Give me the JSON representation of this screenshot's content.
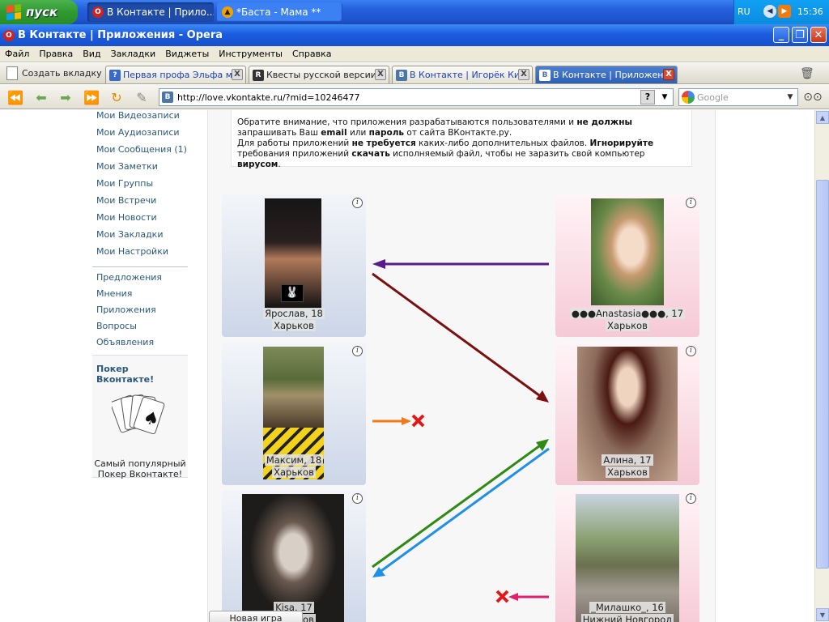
{
  "taskbar": {
    "start_label": "пуск",
    "tasks": [
      {
        "label": "В Контакте | Прило...",
        "active": true
      },
      {
        "label": "*Баста - Мама **",
        "active": false
      }
    ],
    "language": "RU",
    "clock": "15:36"
  },
  "window": {
    "title": "В Контакте | Приложения - Opera"
  },
  "menu": [
    "Файл",
    "Правка",
    "Вид",
    "Закладки",
    "Виджеты",
    "Инструменты",
    "Справка"
  ],
  "tabs": {
    "new_tab_label": "Создать вкладку",
    "items": [
      {
        "label": "Первая профа Эльфа м...",
        "active": false
      },
      {
        "label": "Квесты русской версии...",
        "active": false
      },
      {
        "label": "В Контакте | Игорёк Ки...",
        "active": false
      },
      {
        "label": "В Контакте | Приложения",
        "active": true
      }
    ],
    "close_glyph": "X"
  },
  "address": {
    "url": "http://love.vkontakte.ru/?mid=10246477",
    "help_glyph": "?",
    "search_placeholder": "Google"
  },
  "sidebar": {
    "items": [
      "Мои Видеозаписи",
      "Мои Аудиозаписи",
      "Мои Сообщения (1)",
      "Мои Заметки",
      "Мои Группы",
      "Мои Встречи",
      "Мои Новости",
      "Мои Закладки",
      "Мои Настройки"
    ],
    "items2": [
      "Предложения",
      "Мнения",
      "Приложения",
      "Вопросы",
      "Объявления"
    ],
    "poker": {
      "title": "Покер Вконтакте!",
      "caption_line1": "Самый популярный",
      "caption_line2": "Покер Вконтакте!"
    }
  },
  "notice": {
    "p1_a": "Обратите внимание, что приложения разрабатываются пользователями и ",
    "p1_b": "не должны",
    "p1_c": " запрашивать Ваш ",
    "p1_d": "email",
    "p1_e": " или ",
    "p1_f": "пароль",
    "p1_g": " от сайта ВКонтакте.ру.",
    "p2_a": "Для работы приложений ",
    "p2_b": "не требуется",
    "p2_c": " каких-либо дополнительных файлов. ",
    "p2_d": "Игнорируйте",
    "p2_e": " требования приложений ",
    "p2_f": "скачать",
    "p2_g": " исполняемый файл, чтобы не заразить свой компьютер ",
    "p2_h": "вирусом",
    "p2_i": "."
  },
  "profiles": {
    "male": [
      {
        "name": "Ярослав, 18",
        "city": "Харьков"
      },
      {
        "name": "Максим, 18",
        "city": "Харьков"
      },
      {
        "name": "Kisa, 17",
        "city": "Харьков"
      }
    ],
    "female": [
      {
        "name": "●●●Anastasia●●●, 17",
        "city": "Харьков"
      },
      {
        "name": "Алина, 17",
        "city": "Харьков"
      },
      {
        "name": "_Милашко_, 16",
        "city": "Нижний Новгород"
      }
    ],
    "info_glyph": "i"
  },
  "new_name_button": "Новая игра",
  "colors": {
    "arrow_purple": "#5a1a8c",
    "arrow_darkred": "#7a1010",
    "arrow_orange": "#f07a18",
    "arrow_green": "#2e8a12",
    "arrow_blue": "#1e90e8",
    "arrow_pink": "#e0206e",
    "reject_x": "#e01818",
    "vk_link": "#2b587a"
  }
}
